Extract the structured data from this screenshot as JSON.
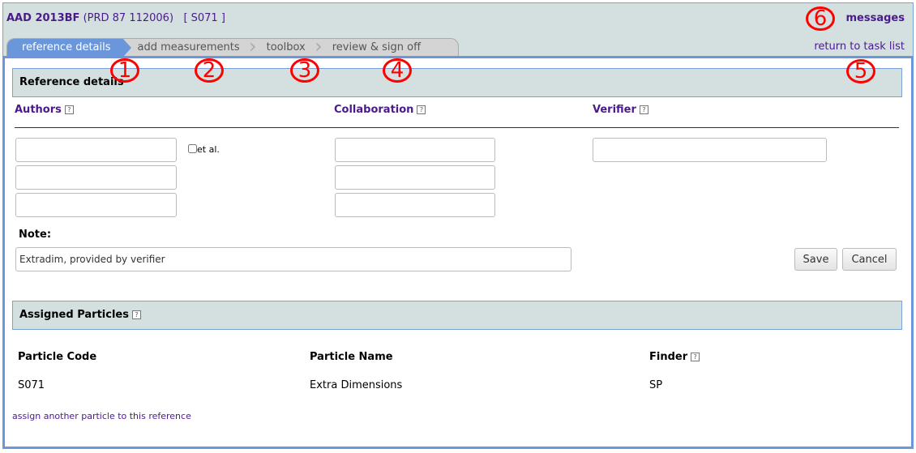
{
  "header": {
    "ref_code": "AAD 2013BF",
    "journal": "(PRD 87 112006)",
    "particle": "[ S071 ]",
    "messages": "messages",
    "return_link": "return to task list"
  },
  "tabs": [
    {
      "label": "reference details",
      "active": true
    },
    {
      "label": "add measurements"
    },
    {
      "label": "toolbox"
    },
    {
      "label": "review & sign off"
    }
  ],
  "reference": {
    "title": "Reference details",
    "authors_label": "Authors",
    "collab_label": "Collaboration",
    "verifier_label": "Verifier",
    "help": "?",
    "etal_label": "et al.",
    "etal_checked": false,
    "authors": [
      "",
      "",
      ""
    ],
    "collaboration": [
      "",
      "",
      ""
    ],
    "verifier": "",
    "note_label": "Note:",
    "note_value": "Extradim, provided by verifier",
    "save": "Save",
    "cancel": "Cancel"
  },
  "particles": {
    "title": "Assigned Particles",
    "headers": [
      "Particle Code",
      "Particle Name",
      "Finder"
    ],
    "rows": [
      [
        "S071",
        "Extra Dimensions",
        "SP"
      ]
    ],
    "assign_link": "assign another particle to this reference"
  },
  "annotations": [
    "1",
    "2",
    "3",
    "4",
    "5",
    "6"
  ],
  "colors": {
    "accent": "#6a96dc",
    "header_bg": "#d4e0e0",
    "link": "#4b1a8a",
    "annotation": "#ff0000"
  }
}
